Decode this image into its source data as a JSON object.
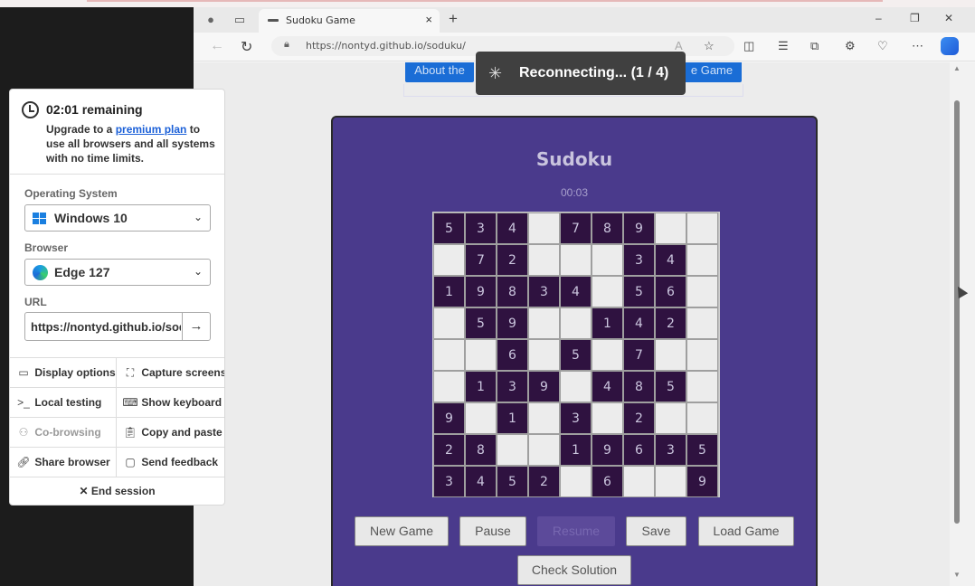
{
  "browser": {
    "tab_title": "Sudoku Game",
    "tab_close": "×",
    "new_tab": "+",
    "url": "https://nontyd.github.io/soduku/",
    "window_controls": [
      "–",
      "❐",
      "✕"
    ]
  },
  "page": {
    "top_buttons": [
      "About the",
      "e Game"
    ],
    "title": "Sudoku",
    "timer": "00:03",
    "grid": [
      [
        "5",
        "3",
        "4",
        "",
        "7",
        "8",
        "9",
        "",
        ""
      ],
      [
        "",
        "7",
        "2",
        "",
        "",
        "",
        "3",
        "4",
        ""
      ],
      [
        "1",
        "9",
        "8",
        "3",
        "4",
        "",
        "5",
        "6",
        ""
      ],
      [
        "",
        "5",
        "9",
        "",
        "",
        "1",
        "4",
        "2",
        ""
      ],
      [
        "",
        "",
        "6",
        "",
        "5",
        "",
        "7",
        "",
        ""
      ],
      [
        "",
        "1",
        "3",
        "9",
        "",
        "4",
        "8",
        "5",
        ""
      ],
      [
        "9",
        "",
        "1",
        "",
        "3",
        "",
        "2",
        "",
        ""
      ],
      [
        "2",
        "8",
        "",
        "",
        "1",
        "9",
        "6",
        "3",
        "5"
      ],
      [
        "3",
        "4",
        "5",
        "2",
        "",
        "6",
        "",
        "",
        "9"
      ]
    ],
    "buttons": {
      "new_game": "New Game",
      "pause": "Pause",
      "resume": "Resume",
      "save": "Save",
      "load_game": "Load Game",
      "check_solution": "Check Solution"
    }
  },
  "toast": {
    "message": "Reconnecting... (1 / 4)"
  },
  "session_panel": {
    "remaining": "02:01 remaining",
    "upgrade_before": "Upgrade to a ",
    "upgrade_link": "premium plan",
    "upgrade_after": " to use all browsers and all systems with no time limits.",
    "os_label": "Operating System",
    "os_value": "Windows 10",
    "browser_label": "Browser",
    "browser_value": "Edge 127",
    "url_label": "URL",
    "url_value": "https://nontyd.github.io/soduku/",
    "go_button": "→",
    "options": [
      {
        "label": "Display options",
        "icon": "monitor-icon"
      },
      {
        "label": "Capture screenshot",
        "icon": "capture-icon"
      },
      {
        "label": "Local testing",
        "icon": "terminal-icon"
      },
      {
        "label": "Show keyboard",
        "icon": "keyboard-icon"
      },
      {
        "label": "Co-browsing",
        "icon": "users-icon"
      },
      {
        "label": "Copy and paste",
        "icon": "clipboard-icon"
      },
      {
        "label": "Share browser",
        "icon": "link-icon"
      },
      {
        "label": "Send feedback",
        "icon": "chat-icon"
      }
    ],
    "end_session": "End session"
  }
}
